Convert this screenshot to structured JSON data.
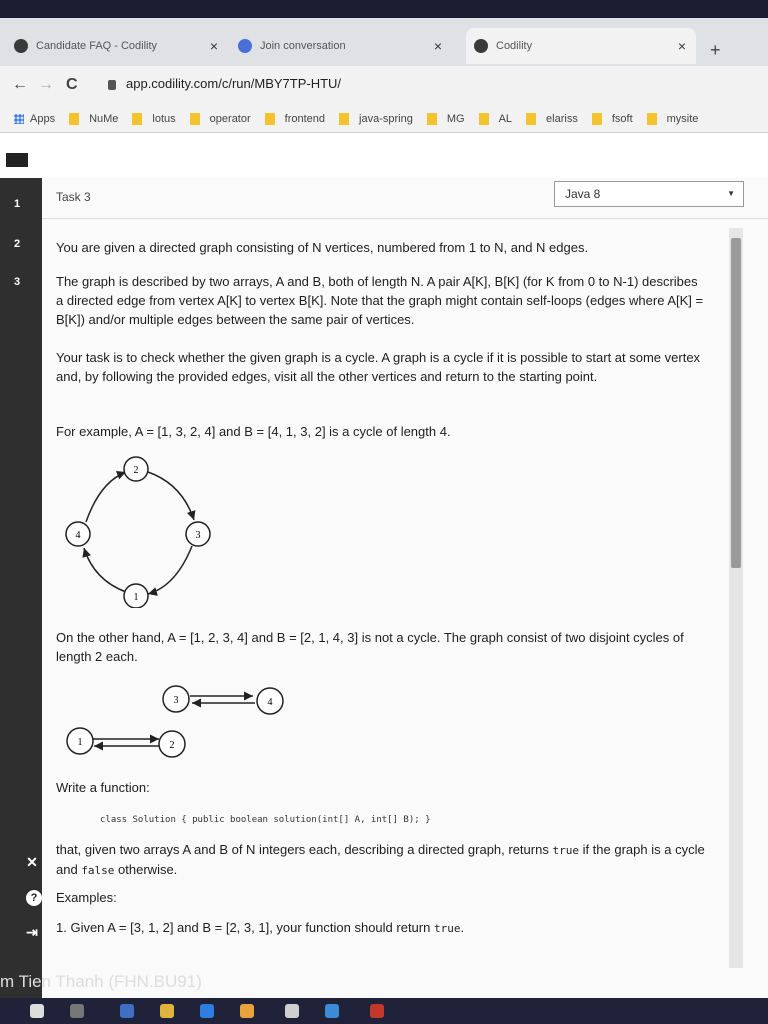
{
  "tabs": [
    {
      "title": "Candidate FAQ - Codility",
      "close": "×"
    },
    {
      "title": "Join conversation",
      "close": "×"
    },
    {
      "title": "Codility",
      "close": "×"
    }
  ],
  "new_tab": "+",
  "nav": {
    "back": "←",
    "forward": "→",
    "reload": "C"
  },
  "url": "app.codility.com/c/run/MBY7TP-HTU/",
  "bookmarks": [
    "Apps",
    "NuMe",
    "lotus",
    "operator",
    "frontend",
    "java-spring",
    "MG",
    "AL",
    "elariss",
    "fsoft",
    "mysite"
  ],
  "rail": {
    "numbers": [
      "1",
      "2",
      "3"
    ]
  },
  "task": {
    "title": "Task 3",
    "language": "Java 8"
  },
  "problem": {
    "p1": "You are given a directed graph consisting of N vertices, numbered from 1 to N, and N edges.",
    "p2": "The graph is described by two arrays, A and B, both of length N. A pair A[K], B[K] (for K from 0 to N-1) describes a directed edge from vertex A[K] to vertex B[K]. Note that the graph might contain self-loops (edges where A[K] = B[K]) and/or multiple edges between the same pair of vertices.",
    "p3": "Your task is to check whether the given graph is a cycle. A graph is a cycle if it is possible to start at some vertex and, by following the provided edges, visit all the other vertices and return to the starting point.",
    "p4": "For example, A = [1, 3, 2, 4] and B = [4, 1, 3, 2] is a cycle of length 4.",
    "p5": "On the other hand, A = [1, 2, 3, 4] and B = [2, 1, 4, 3] is not a cycle. The graph consist of two disjoint cycles of length 2 each.",
    "p6": "Write a function:",
    "code": "class Solution { public boolean solution(int[] A, int[] B); }",
    "p7a": "that, given two arrays A and B of N integers each, describing a directed graph, returns ",
    "p7true": "true",
    "p7b": " if the graph is a cycle and ",
    "p7false": "false",
    "p7c": " otherwise.",
    "examples": "Examples:",
    "ex1a": "1. Given A = [3, 1, 2] and B = [2, 3, 1], your function should return ",
    "ex1true": "true",
    "ex1end": "."
  },
  "diagram1": {
    "nodes": [
      "1",
      "2",
      "3",
      "4"
    ]
  },
  "diagram2": {
    "nodes": [
      "1",
      "2",
      "3",
      "4"
    ]
  },
  "user": "m Tien Thanh (FHN.BU91)"
}
